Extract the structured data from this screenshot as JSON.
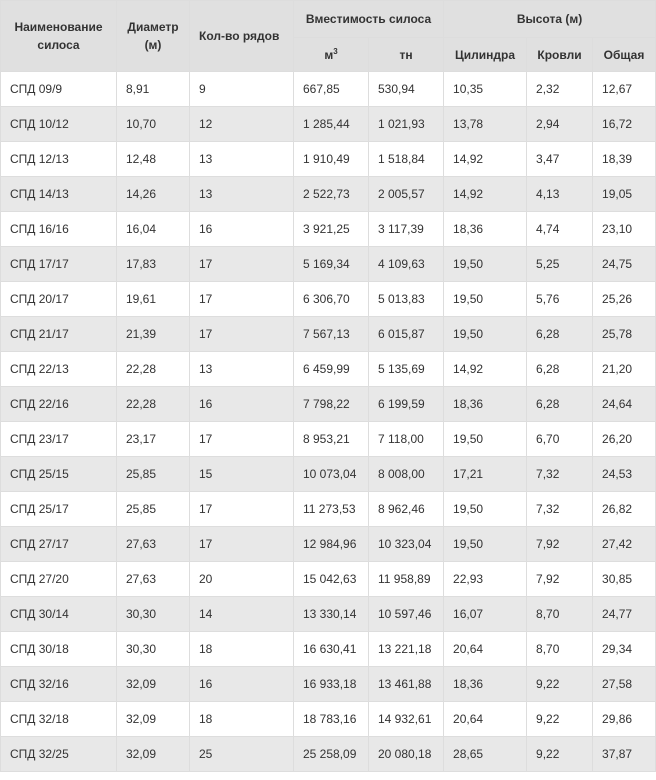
{
  "headers": {
    "name": "Наименование силоса",
    "diameter": "Диаметр (м)",
    "rows": "Кол-во рядов",
    "capacity": "Вместимость силоса",
    "height": "Высота (м)",
    "m3_base": "м",
    "m3_sup": "3",
    "tons": "тн",
    "cylinder": "Цилиндра",
    "roof": "Кровли",
    "total": "Общая"
  },
  "rows": [
    [
      "СПД 09/9",
      "8,91",
      "9",
      "667,85",
      "530,94",
      "10,35",
      "2,32",
      "12,67"
    ],
    [
      "СПД 10/12",
      "10,70",
      "12",
      "1 285,44",
      "1 021,93",
      "13,78",
      "2,94",
      "16,72"
    ],
    [
      "СПД 12/13",
      "12,48",
      "13",
      "1 910,49",
      "1 518,84",
      "14,92",
      "3,47",
      "18,39"
    ],
    [
      "СПД 14/13",
      "14,26",
      "13",
      "2 522,73",
      "2 005,57",
      "14,92",
      "4,13",
      "19,05"
    ],
    [
      "СПД 16/16",
      "16,04",
      "16",
      "3 921,25",
      "3 117,39",
      "18,36",
      "4,74",
      "23,10"
    ],
    [
      "СПД 17/17",
      "17,83",
      "17",
      "5 169,34",
      "4 109,63",
      "19,50",
      "5,25",
      "24,75"
    ],
    [
      "СПД 20/17",
      "19,61",
      "17",
      "6 306,70",
      "5 013,83",
      "19,50",
      "5,76",
      "25,26"
    ],
    [
      "СПД 21/17",
      "21,39",
      "17",
      "7 567,13",
      "6 015,87",
      "19,50",
      "6,28",
      "25,78"
    ],
    [
      "СПД 22/13",
      "22,28",
      "13",
      "6 459,99",
      "5 135,69",
      "14,92",
      "6,28",
      "21,20"
    ],
    [
      "СПД 22/16",
      "22,28",
      "16",
      "7 798,22",
      "6 199,59",
      "18,36",
      "6,28",
      "24,64"
    ],
    [
      "СПД 23/17",
      "23,17",
      "17",
      "8 953,21",
      "7 118,00",
      "19,50",
      "6,70",
      "26,20"
    ],
    [
      "СПД 25/15",
      "25,85",
      "15",
      "10 073,04",
      "8 008,00",
      "17,21",
      "7,32",
      "24,53"
    ],
    [
      "СПД 25/17",
      "25,85",
      "17",
      "11 273,53",
      "8 962,46",
      "19,50",
      "7,32",
      "26,82"
    ],
    [
      "СПД 27/17",
      "27,63",
      "17",
      "12 984,96",
      "10 323,04",
      "19,50",
      "7,92",
      "27,42"
    ],
    [
      "СПД 27/20",
      "27,63",
      "20",
      "15 042,63",
      "11 958,89",
      "22,93",
      "7,92",
      "30,85"
    ],
    [
      "СПД 30/14",
      "30,30",
      "14",
      "13 330,14",
      "10 597,46",
      "16,07",
      "8,70",
      "24,77"
    ],
    [
      "СПД 30/18",
      "30,30",
      "18",
      "16 630,41",
      "13 221,18",
      "20,64",
      "8,70",
      "29,34"
    ],
    [
      "СПД 32/16",
      "32,09",
      "16",
      "16 933,18",
      "13 461,88",
      "18,36",
      "9,22",
      "27,58"
    ],
    [
      "СПД 32/18",
      "32,09",
      "18",
      "18 783,16",
      "14 932,61",
      "20,64",
      "9,22",
      "29,86"
    ],
    [
      "СПД 32/25",
      "32,09",
      "25",
      "25 258,09",
      "20 080,18",
      "28,65",
      "9,22",
      "37,87"
    ]
  ]
}
